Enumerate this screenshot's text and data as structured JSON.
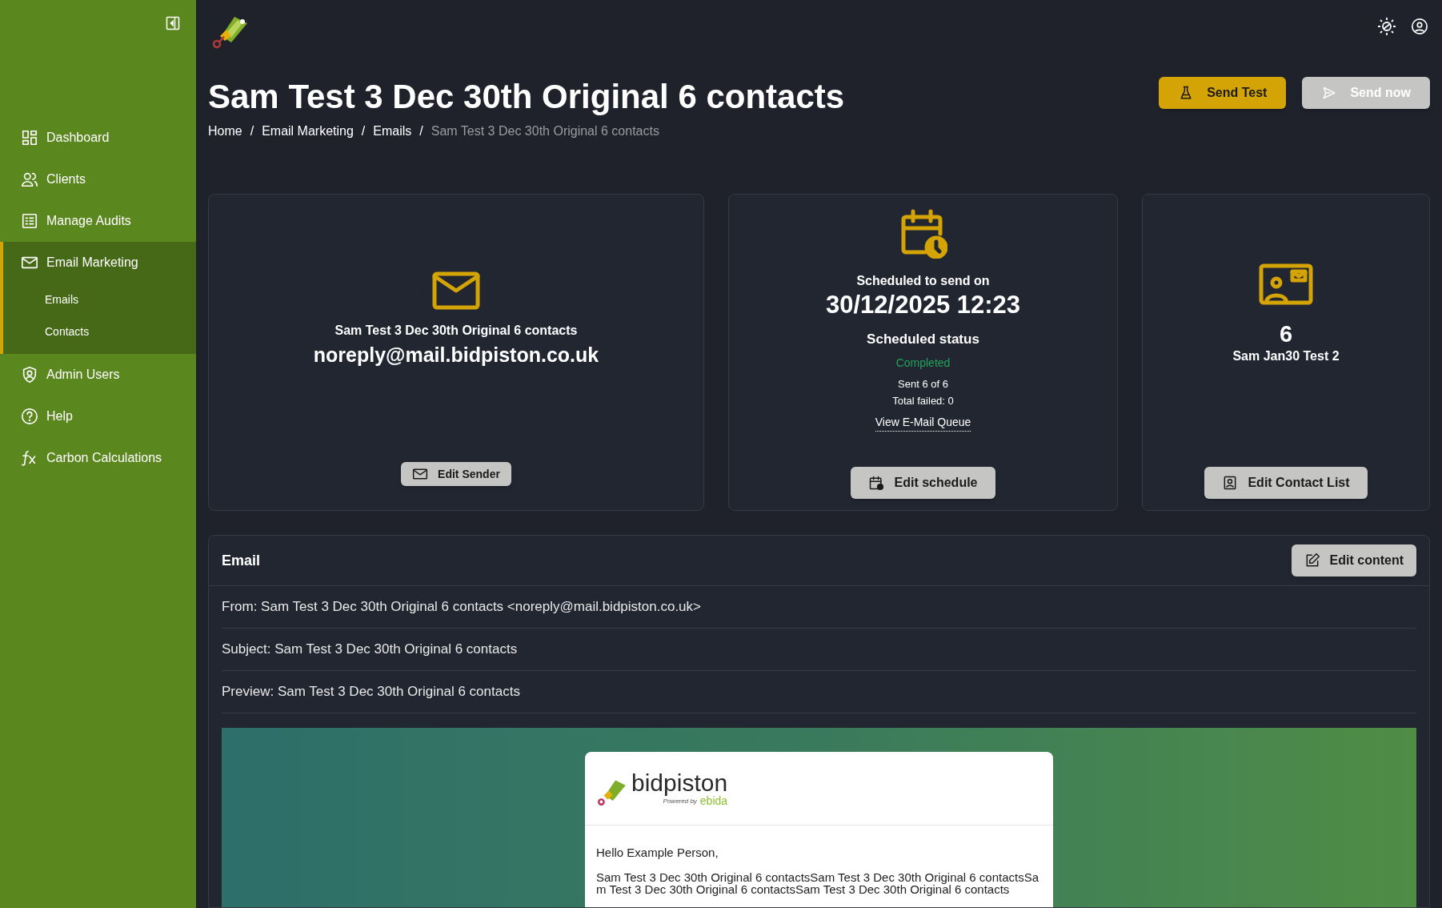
{
  "sidebar": {
    "items": [
      {
        "label": "Dashboard",
        "selected": false
      },
      {
        "label": "Clients",
        "selected": false
      },
      {
        "label": "Manage Audits",
        "selected": false
      },
      {
        "label": "Email Marketing",
        "selected": true,
        "expanded": true,
        "children": [
          {
            "label": "Emails",
            "selected": false
          },
          {
            "label": "Contacts",
            "selected": false
          }
        ]
      },
      {
        "label": "Admin Users",
        "selected": false
      },
      {
        "label": "Help",
        "selected": false
      },
      {
        "label": "Carbon Calculations",
        "selected": false
      }
    ]
  },
  "header": {
    "title": "Sam Test 3 Dec 30th Original 6 contacts",
    "breadcrumb": [
      {
        "kind": "link",
        "text": "Home"
      },
      {
        "kind": "separator",
        "text": "/"
      },
      {
        "kind": "link",
        "text": "Email Marketing"
      },
      {
        "kind": "separator",
        "text": "/"
      },
      {
        "kind": "link",
        "text": "Emails"
      },
      {
        "kind": "separator",
        "text": "/"
      },
      {
        "kind": "current",
        "text": "Sam Test 3 Dec 30th Original 6 contacts"
      }
    ],
    "buttons": [
      {
        "label": "Send Test",
        "disabled": false
      },
      {
        "label": "Send now",
        "disabled": true
      }
    ]
  },
  "sender_card": {
    "name": "Sam Test 3 Dec 30th Original 6 contacts",
    "email": "noreply@mail.bidpiston.co.uk",
    "button": "Edit Sender"
  },
  "schedule_card": {
    "caption": "Scheduled to send on",
    "datetime": "30/12/2025 12:23",
    "status_label": "Scheduled status",
    "status": "Completed",
    "status_ok": true,
    "sent": "Sent 6 of 6",
    "failed": "Total failed: 0",
    "link": "View E-Mail Queue",
    "button": "Edit schedule"
  },
  "contacts_card": {
    "count": "6",
    "list_name": "Sam Jan30 Test 2",
    "button": "Edit Contact List"
  },
  "email": {
    "title": "Email",
    "button": "Edit content",
    "rows": [
      "From: Sam Test 3 Dec 30th Original 6 contacts <noreply@mail.bidpiston.co.uk>",
      "Subject: Sam Test 3 Dec 30th Original 6 contacts",
      "Preview: Sam Test 3 Dec 30th Original 6 contacts"
    ],
    "preview": {
      "brand": "bidpiston",
      "powered_by": "Powered by",
      "powered_brand": "ebida",
      "greeting": "Hello Example Person,",
      "body": "Sam Test 3 Dec 30th Original 6 contactsSam Test 3 Dec 30th Original 6 contactsSam Test 3 Dec 30th Original 6 contactsSam Test 3 Dec 30th Original 6 contacts"
    }
  }
}
